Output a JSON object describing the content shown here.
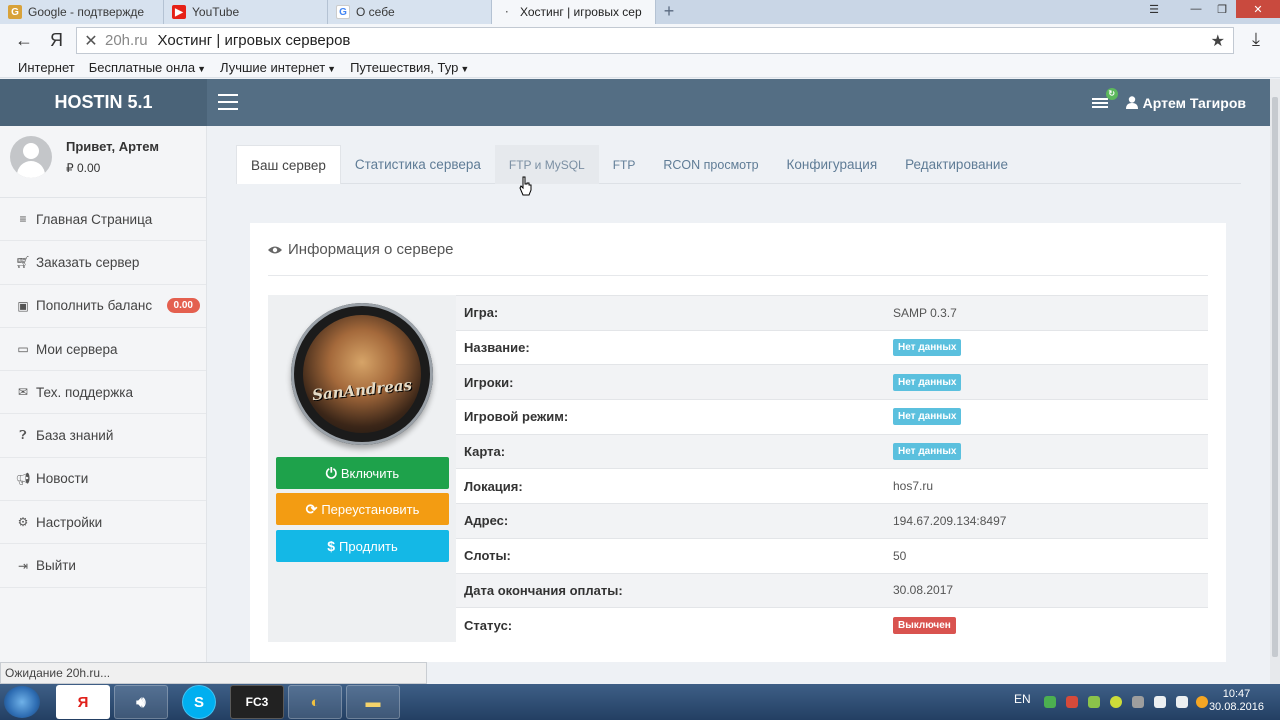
{
  "browser": {
    "tabs": [
      {
        "label": "Google - подтвержде"
      },
      {
        "label": "YouTube"
      },
      {
        "label": "О себе"
      },
      {
        "label": "Хостинг | игровых сер"
      }
    ],
    "address": {
      "domain": "20h.ru",
      "title": "Хостинг | игровых серверов"
    },
    "bookmarks": [
      {
        "label": "Интернет"
      },
      {
        "label": "Бесплатные онла"
      },
      {
        "label": "Лучшие интернет"
      },
      {
        "label": "Путешествия, Тур"
      }
    ],
    "status_text": "Ожидание 20h.ru..."
  },
  "site": {
    "brand": "HOSTIN 5.1",
    "user_name": "Артем Тагиров"
  },
  "sidebar": {
    "greeting": "Привет, Артем",
    "balance": "₽ 0.00",
    "items": [
      {
        "label": "Главная Страница",
        "icon": "list-icon"
      },
      {
        "label": "Заказать сервер",
        "icon": "cart-icon"
      },
      {
        "label": "Пополнить баланс",
        "icon": "money-icon",
        "badge": "0.00"
      },
      {
        "label": "Мои сервера",
        "icon": "laptop-icon"
      },
      {
        "label": "Тех. поддержка",
        "icon": "envelope-icon"
      },
      {
        "label": "База знаний",
        "icon": "question-icon"
      },
      {
        "label": "Новости",
        "icon": "bullhorn-icon"
      },
      {
        "label": "Настройки",
        "icon": "gears-icon"
      },
      {
        "label": "Выйти",
        "icon": "sign-out-icon"
      }
    ]
  },
  "tabs": [
    {
      "label": "Ваш сервер"
    },
    {
      "label": "Статистика сервера"
    },
    {
      "label": "FTP и MySQL"
    },
    {
      "label": "FTP"
    },
    {
      "label": "RCON просмотр"
    },
    {
      "label": "Конфигурация"
    },
    {
      "label": "Редактирование"
    }
  ],
  "panel": {
    "title": "Информация о сервере",
    "logo_text": "SanAndreas",
    "buttons": {
      "start": "Включить",
      "reinstall": "Переустановить",
      "renew": "Продлить"
    },
    "rows": [
      {
        "key": "Игра:",
        "value": "SAMP 0.3.7",
        "type": "text"
      },
      {
        "key": "Название:",
        "value": "Нет данных",
        "type": "info"
      },
      {
        "key": "Игроки:",
        "value": "Нет данных",
        "type": "info"
      },
      {
        "key": "Игровой режим:",
        "value": "Нет данных",
        "type": "info"
      },
      {
        "key": "Карта:",
        "value": "Нет данных",
        "type": "info"
      },
      {
        "key": "Локация:",
        "value": "hos7.ru",
        "type": "text"
      },
      {
        "key": "Адрес:",
        "value": "194.67.209.134:8497",
        "type": "text"
      },
      {
        "key": "Слоты:",
        "value": "50",
        "type": "text"
      },
      {
        "key": "Дата окончания оплаты:",
        "value": "30.08.2017",
        "type": "text"
      },
      {
        "key": "Статус:",
        "value": "Выключен",
        "type": "danger"
      }
    ]
  },
  "taskbar": {
    "lang": "EN",
    "time": "10:47",
    "date": "30.08.2016",
    "apps": [
      "Я",
      "",
      "S",
      "FC3",
      "",
      ""
    ]
  },
  "colors": {
    "header": "#546e84",
    "green": "#1ea24b",
    "orange": "#f39c12",
    "cyan": "#14b8e6",
    "badge_info": "#5bc0de",
    "badge_danger": "#d9534f"
  }
}
